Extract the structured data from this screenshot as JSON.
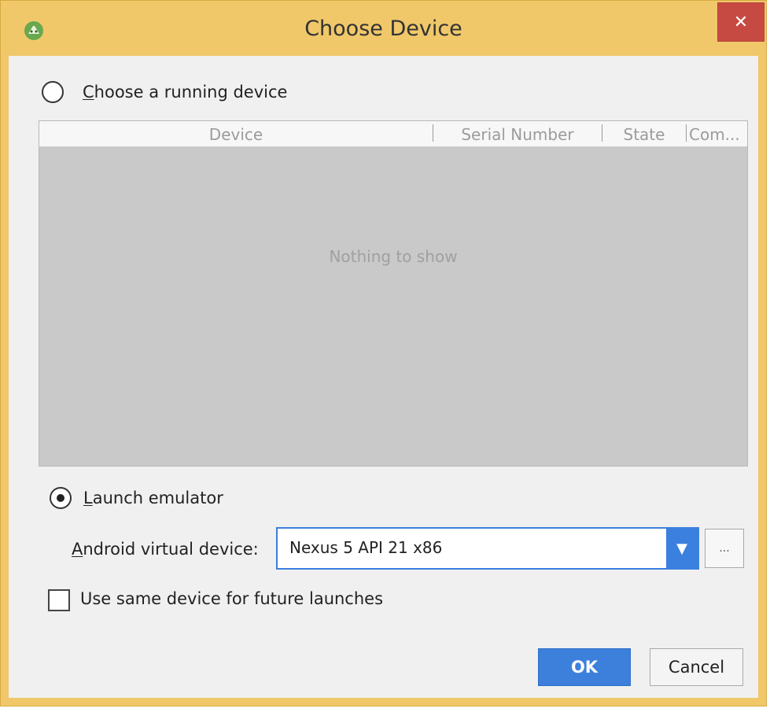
{
  "window": {
    "title": "Choose Device",
    "close_glyph": "✕",
    "app_icon": "android-studio-icon"
  },
  "running_device": {
    "selected": false,
    "label_mnemonic": "C",
    "label_rest": "hoose a running device"
  },
  "device_table": {
    "columns": [
      "Device",
      "Serial Number",
      "State",
      "Com..."
    ],
    "rows": [],
    "empty_text": "Nothing to show"
  },
  "launch_emulator": {
    "selected": true,
    "label_mnemonic": "L",
    "label_rest": "aunch emulator"
  },
  "avd": {
    "label_mnemonic": "A",
    "label_rest": "ndroid virtual device:",
    "value": "Nexus 5 API 21 x86",
    "arrow_glyph": "▼",
    "more_label": "..."
  },
  "same_device": {
    "checked": false,
    "label": "Use same device for future launches"
  },
  "buttons": {
    "ok": "OK",
    "cancel": "Cancel"
  },
  "colors": {
    "title_bar": "#f0c86a",
    "accent_blue": "#3c80dc",
    "close_red": "#c74a42"
  }
}
